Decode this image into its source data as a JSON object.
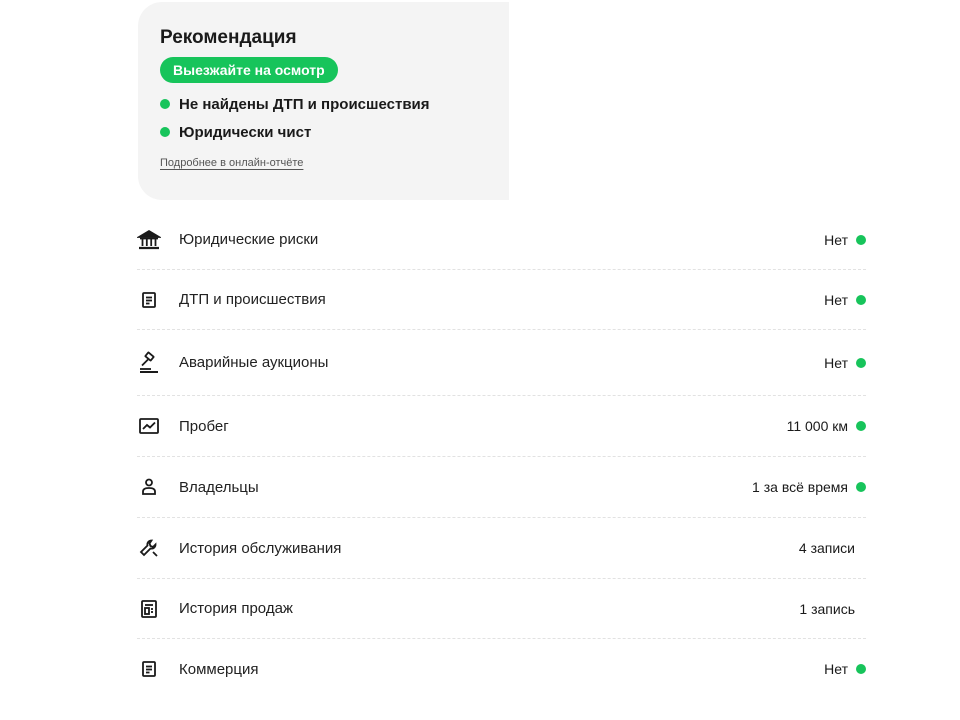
{
  "recommendation": {
    "title": "Рекомендация",
    "verdict": "Выезжайте на осмотр",
    "bullets": [
      {
        "text": "Не найдены ДТП и происшествия",
        "color": "#17c45b"
      },
      {
        "text": "Юридически чист",
        "color": "#17c45b"
      }
    ],
    "link": "Подробнее в онлайн-отчёте"
  },
  "rows": [
    {
      "icon": "bank-icon",
      "label": "Юридические риски",
      "value": "Нет",
      "status": "green"
    },
    {
      "icon": "document-icon",
      "label": "ДТП и происшествия",
      "value": "Нет",
      "status": "green"
    },
    {
      "icon": "gavel-icon",
      "label": "Аварийные аукционы",
      "value": "Нет",
      "status": "green"
    },
    {
      "icon": "chart-icon",
      "label": "Пробег",
      "value": "11 000 км",
      "status": "green"
    },
    {
      "icon": "person-icon",
      "label": "Владельцы",
      "value": "1 за всё время",
      "status": "green"
    },
    {
      "icon": "wrench-icon",
      "label": "История обслуживания",
      "value": "4 записи",
      "status": "none"
    },
    {
      "icon": "price-list-icon",
      "label": "История продаж",
      "value": "1 запись",
      "status": "none"
    },
    {
      "icon": "document-icon",
      "label": "Коммерция",
      "value": "Нет",
      "status": "green"
    }
  ],
  "colors": {
    "accent": "#17c45b",
    "card_bg": "#f4f4f4"
  }
}
